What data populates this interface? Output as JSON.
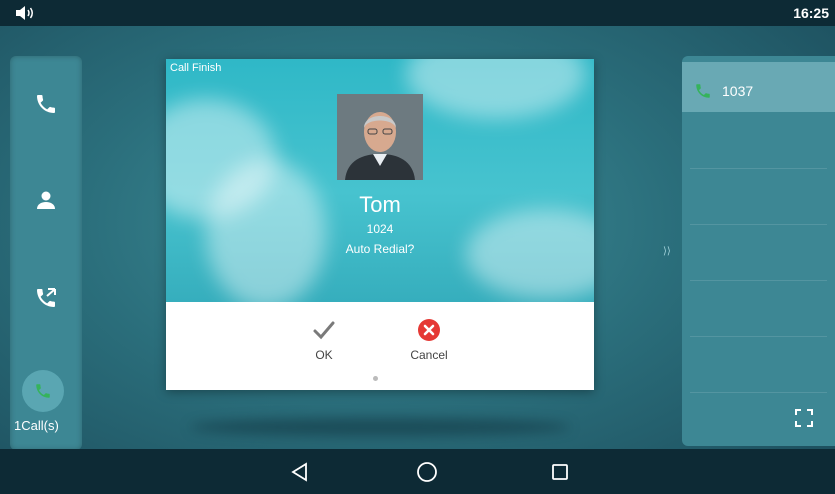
{
  "status_bar": {
    "time": "16:25",
    "volume_icon": "volume-icon"
  },
  "sidebar": {
    "items": [
      {
        "icon": "phone-icon"
      },
      {
        "icon": "contact-icon"
      },
      {
        "icon": "call-history-icon"
      }
    ],
    "active_calls_label": "1Call(s)"
  },
  "dialog": {
    "title": "Call Finish",
    "contact_name": "Tom",
    "contact_number": "1024",
    "question": "Auto Redial?",
    "ok_label": "OK",
    "cancel_label": "Cancel"
  },
  "line_panel": {
    "line_number": "1037"
  },
  "colors": {
    "accent": "#3d8794",
    "dialog_top": "#2fb8c7",
    "cancel_red": "#e53935",
    "call_green": "#35b35b"
  }
}
